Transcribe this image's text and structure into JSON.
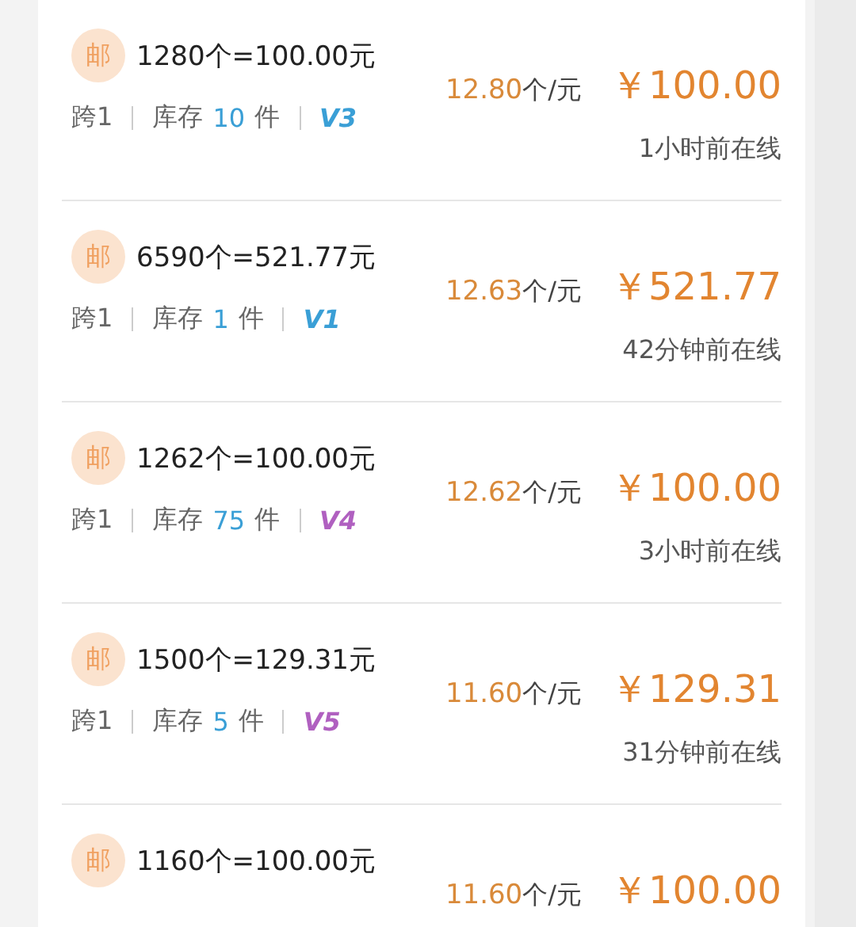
{
  "listings": [
    {
      "badge": "邮",
      "title": "1280个=100.00元",
      "cross": "跨1",
      "stock_label": "库存",
      "stock": "10",
      "stock_unit": "件",
      "tier": "V3",
      "color": "#3a9fd6",
      "rate": "12.80",
      "rate_unit": "个/元",
      "price": "￥100.00",
      "online": "1小时前在线"
    },
    {
      "badge": "邮",
      "title": "6590个=521.77元",
      "cross": "跨1",
      "stock_label": "库存",
      "stock": "1",
      "stock_unit": "件",
      "tier": "V1",
      "color": "#3a9fd6",
      "rate": "12.63",
      "rate_unit": "个/元",
      "price": "￥521.77",
      "online": "42分钟前在线"
    },
    {
      "badge": "邮",
      "title": "1262个=100.00元",
      "cross": "跨1",
      "stock_label": "库存",
      "stock": "75",
      "stock_unit": "件",
      "tier": "V4",
      "color": "#b060c0",
      "rate": "12.62",
      "rate_unit": "个/元",
      "price": "￥100.00",
      "online": "3小时前在线"
    },
    {
      "badge": "邮",
      "title": "1500个=129.31元",
      "cross": "跨1",
      "stock_label": "库存",
      "stock": "5",
      "stock_unit": "件",
      "tier": "V5",
      "color": "#b060c0",
      "rate": "11.60",
      "rate_unit": "个/元",
      "price": "￥129.31",
      "online": "31分钟前在线"
    },
    {
      "badge": "邮",
      "title": "1160个=100.00元",
      "rate": "11.60",
      "rate_unit": "个/元",
      "price": "￥100.00"
    }
  ]
}
